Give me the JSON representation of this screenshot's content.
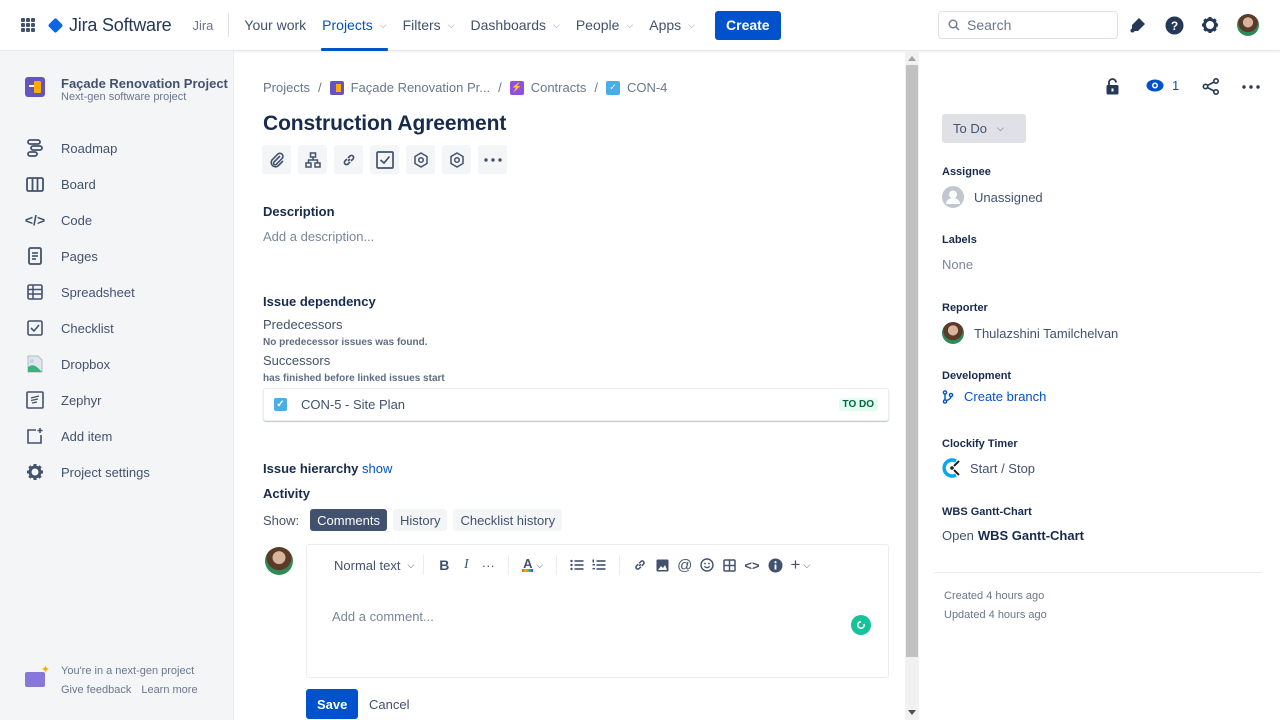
{
  "topnav": {
    "product": "Jira Software",
    "site": "Jira",
    "items": [
      {
        "label": "Your work",
        "dropdown": false,
        "active": false
      },
      {
        "label": "Projects",
        "dropdown": true,
        "active": true
      },
      {
        "label": "Filters",
        "dropdown": true,
        "active": false
      },
      {
        "label": "Dashboards",
        "dropdown": true,
        "active": false
      },
      {
        "label": "People",
        "dropdown": true,
        "active": false
      },
      {
        "label": "Apps",
        "dropdown": true,
        "active": false
      }
    ],
    "create_label": "Create",
    "search_placeholder": "Search",
    "icons": [
      "notifications-icon",
      "help-icon",
      "settings-icon",
      "profile-avatar"
    ]
  },
  "sidebar": {
    "project_name": "Façade Renovation Project",
    "project_type": "Next-gen software project",
    "items": [
      {
        "label": "Roadmap",
        "icon": "roadmap-icon"
      },
      {
        "label": "Board",
        "icon": "board-icon"
      },
      {
        "label": "Code",
        "icon": "code-icon"
      },
      {
        "label": "Pages",
        "icon": "pages-icon"
      },
      {
        "label": "Spreadsheet",
        "icon": "spreadsheet-icon"
      },
      {
        "label": "Checklist",
        "icon": "checklist-icon"
      },
      {
        "label": "Dropbox",
        "icon": "dropbox-icon"
      },
      {
        "label": "Zephyr",
        "icon": "zephyr-icon"
      },
      {
        "label": "Add item",
        "icon": "add-item-icon"
      },
      {
        "label": "Project settings",
        "icon": "gear-icon"
      }
    ],
    "footer": {
      "text": "You're in a next-gen project",
      "feedback": "Give feedback",
      "learn_more": "Learn more"
    }
  },
  "issue": {
    "breadcrumb": [
      "Projects",
      "Façade Renovation Pr...",
      "Contracts",
      "CON-4"
    ],
    "title": "Construction Agreement",
    "toolbar": [
      "attach-icon",
      "child-issue-icon",
      "link-issue-icon",
      "checklist-icon",
      "app-icon",
      "app-icon",
      "more-icon"
    ],
    "description_label": "Description",
    "description_placeholder": "Add a description...",
    "dependency": {
      "heading": "Issue dependency",
      "predecessors_label": "Predecessors",
      "predecessors_text": "No predecessor issues was found.",
      "successors_label": "Successors",
      "successors_text": "has finished before linked issues start",
      "linked": [
        {
          "key_summary": "CON-5 - Site Plan",
          "status": "TO DO"
        }
      ]
    },
    "hierarchy_label": "Issue hierarchy",
    "hierarchy_link": "show",
    "activity": {
      "heading": "Activity",
      "show_label": "Show:",
      "filters": [
        {
          "label": "Comments",
          "active": true
        },
        {
          "label": "History",
          "active": false
        },
        {
          "label": "Checklist history",
          "active": false
        }
      ],
      "editor": {
        "text_style": "Normal text",
        "placeholder": "Add a comment...",
        "save_label": "Save",
        "cancel_label": "Cancel"
      }
    }
  },
  "details": {
    "watchers": "1",
    "status": "To Do",
    "assignee_label": "Assignee",
    "assignee": "Unassigned",
    "labels_label": "Labels",
    "labels": "None",
    "reporter_label": "Reporter",
    "reporter": "Thulazshini Tamilchelvan",
    "development_label": "Development",
    "development_action": "Create branch",
    "clockify_label": "Clockify Timer",
    "clockify_action": "Start / Stop",
    "wbs_label": "WBS Gantt-Chart",
    "wbs_prefix": "Open",
    "wbs_link": "WBS Gantt-Chart",
    "created": "Created 4 hours ago",
    "updated": "Updated 4 hours ago"
  },
  "colors": {
    "brand": "#0052cc",
    "todo_lozenge_bg": "#e3fcef",
    "todo_lozenge_fg": "#006644",
    "sidebar_bg": "#f4f5f7"
  }
}
